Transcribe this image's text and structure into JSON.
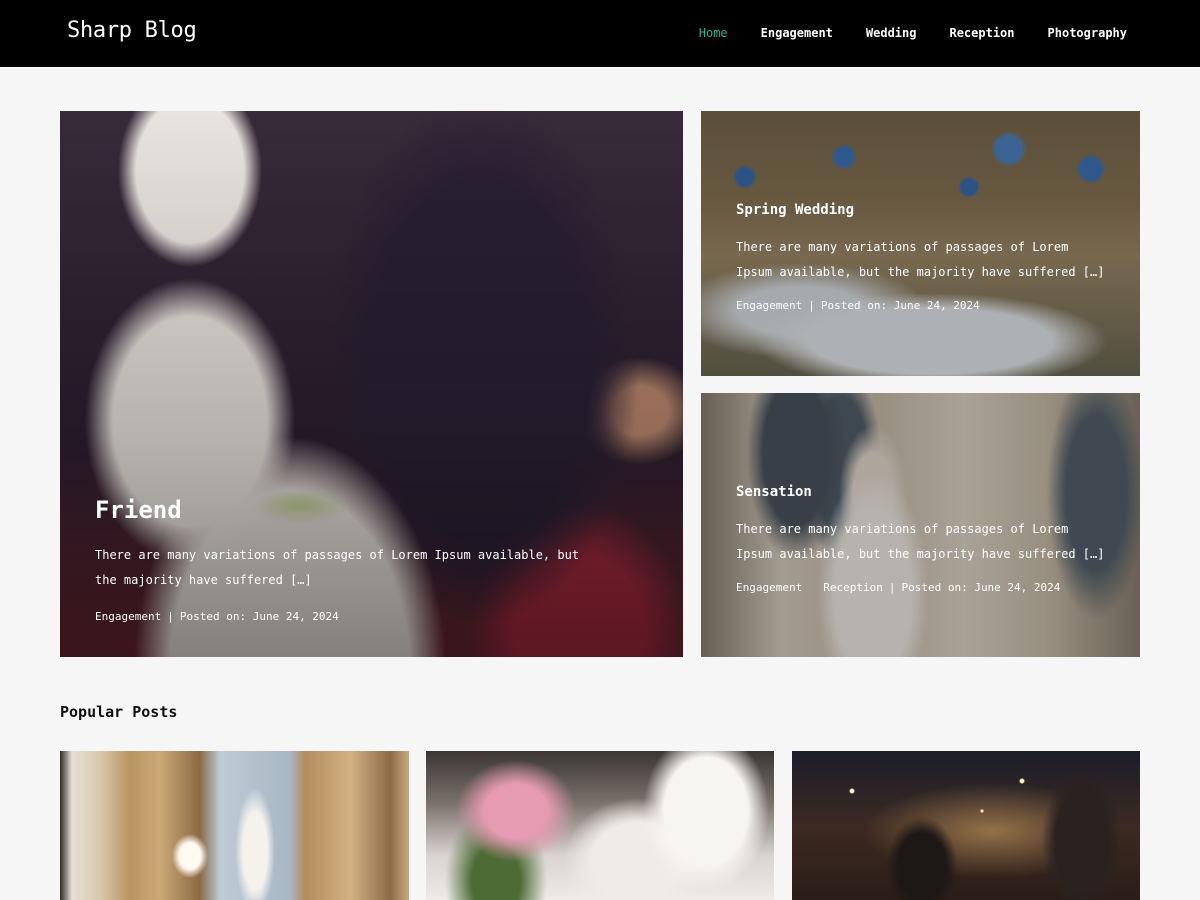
{
  "header": {
    "logo": "Sharp Blog",
    "nav": [
      {
        "label": "Home",
        "active": true
      },
      {
        "label": "Engagement",
        "active": false
      },
      {
        "label": "Wedding",
        "active": false
      },
      {
        "label": "Reception",
        "active": false
      },
      {
        "label": "Photography",
        "active": false
      }
    ],
    "active_color": "#1fb391"
  },
  "featured": {
    "big": {
      "title": "Friend",
      "excerpt": "There are many variations of passages of Lorem Ipsum available, but the majority have suffered […]",
      "category": "Engagement",
      "separator": "|",
      "posted": "Posted on: June 24, 2024"
    },
    "small_1": {
      "title": "Spring Wedding",
      "excerpt": "There are many variations of passages of Lorem Ipsum available, but the majority have suffered […]",
      "category": "Engagement",
      "separator": "|",
      "posted": "Posted on: June 24, 2024"
    },
    "small_2": {
      "title": "Sensation",
      "excerpt": "There are many variations of passages of Lorem Ipsum available, but the majority have suffered […]",
      "category_1": "Engagement",
      "category_2": "Reception",
      "separator": "|",
      "posted": "Posted on: June 24, 2024"
    }
  },
  "popular": {
    "title": "Popular Posts"
  }
}
